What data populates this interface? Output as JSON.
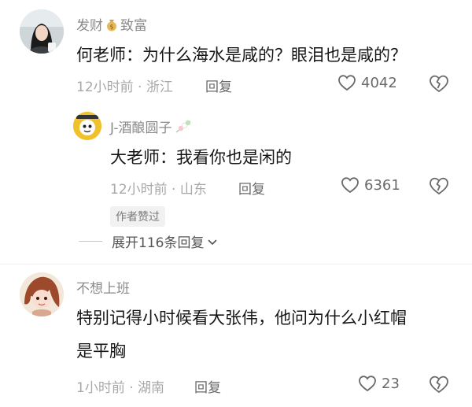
{
  "comments": [
    {
      "username_part1": "发财",
      "username_emoji": "money-bag",
      "username_part2": "致富",
      "text": "何老师：为什么海水是咸的？眼泪也是咸的？",
      "time": "12小时前 · 浙江",
      "reply_label": "回复",
      "likes": "4042",
      "reply": {
        "username": "J-酒酿圆子",
        "username_emoji": "tangyuan-skewer",
        "text": "大老师：我看你也是闲的",
        "time": "12小时前 · 山东",
        "reply_label": "回复",
        "likes": "6361",
        "badge": "作者赞过"
      },
      "expand_label": "展开116条回复"
    },
    {
      "username": "不想上班",
      "text_line1": "特别记得小时候看大张伟，他问为什么小红帽",
      "text_line2": "是平胸",
      "time": "1小时前 · 湖南",
      "reply_label": "回复",
      "likes": "23"
    }
  ]
}
